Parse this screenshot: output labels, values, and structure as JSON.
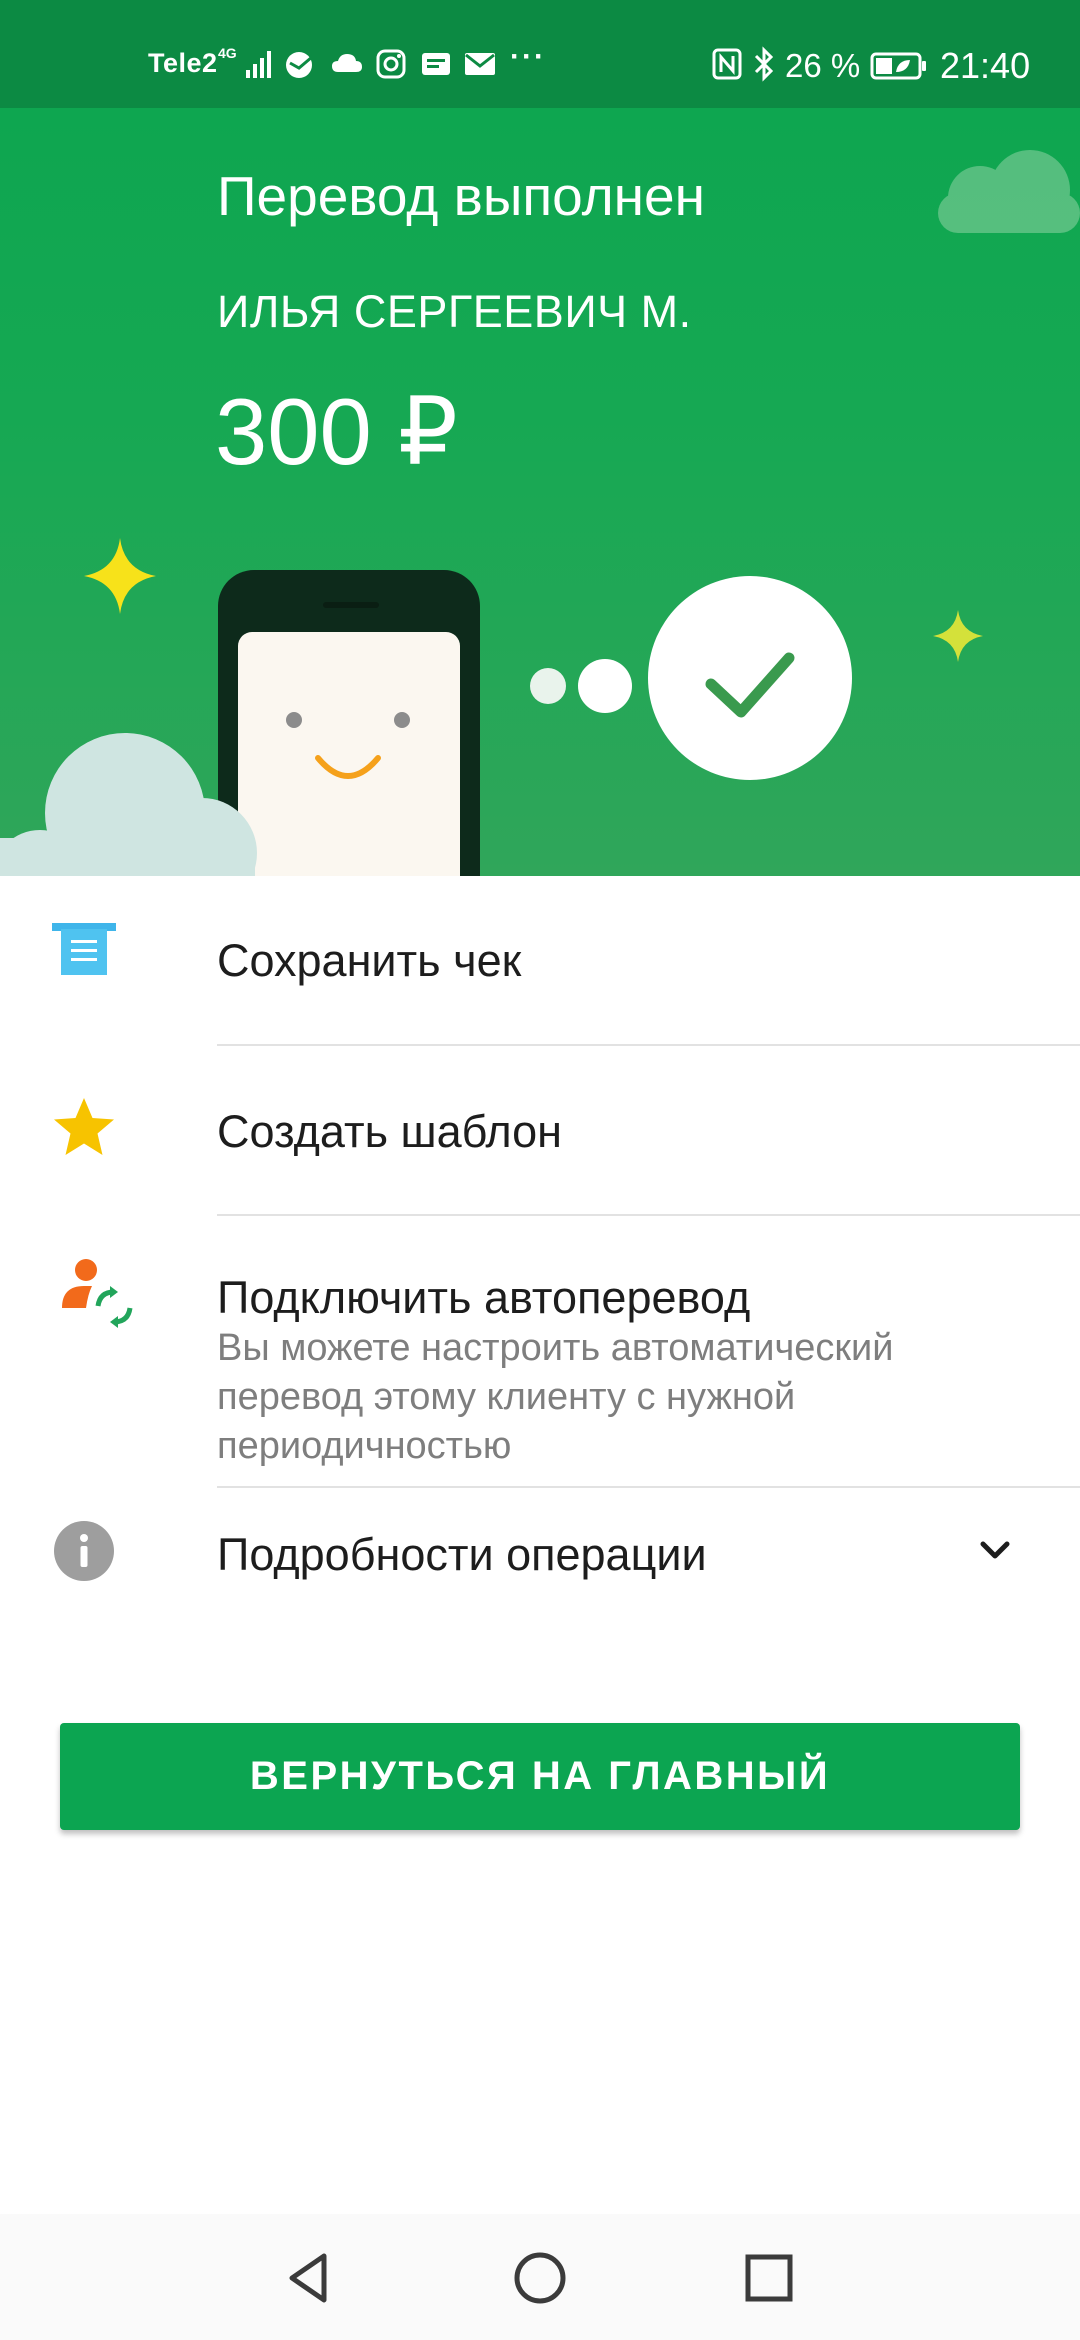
{
  "status_bar": {
    "carrier": "Tele2",
    "network": "4G",
    "battery_percent": "26 %",
    "time": "21:40",
    "icons": [
      "signal-icon",
      "sberbank-icon",
      "cloud-icon",
      "instagram-icon",
      "message-icon",
      "mail-icon",
      "more-dots-icon",
      "nfc-icon",
      "bluetooth-icon",
      "battery-icon"
    ],
    "more_dots": "···"
  },
  "hero": {
    "title": "Перевод выполнен",
    "recipient": "ИЛЬЯ СЕРГЕЕВИЧ М.",
    "amount": "300 ₽"
  },
  "actions": [
    {
      "label": "Сохранить чек",
      "icon": "receipt-icon"
    },
    {
      "label": "Создать шаблон",
      "icon": "star-icon"
    },
    {
      "label": "Подключить автоперевод",
      "icon": "autotransfer-icon",
      "description": "Вы можете настроить автоматический перевод этому клиенту с нужной периодичностью"
    },
    {
      "label": "Подробности операции",
      "icon": "info-icon"
    }
  ],
  "primary_button": {
    "label": "ВЕРНУТЬСЯ НА ГЛАВНЫЙ"
  },
  "nav_bar": {
    "icons": [
      "back-icon",
      "home-icon",
      "recents-icon"
    ]
  },
  "colors": {
    "brand_green": "#0ca551",
    "status_bar": "#0c8a43",
    "accent_yellow": "#f5c400",
    "accent_blue": "#3fb5ea"
  }
}
